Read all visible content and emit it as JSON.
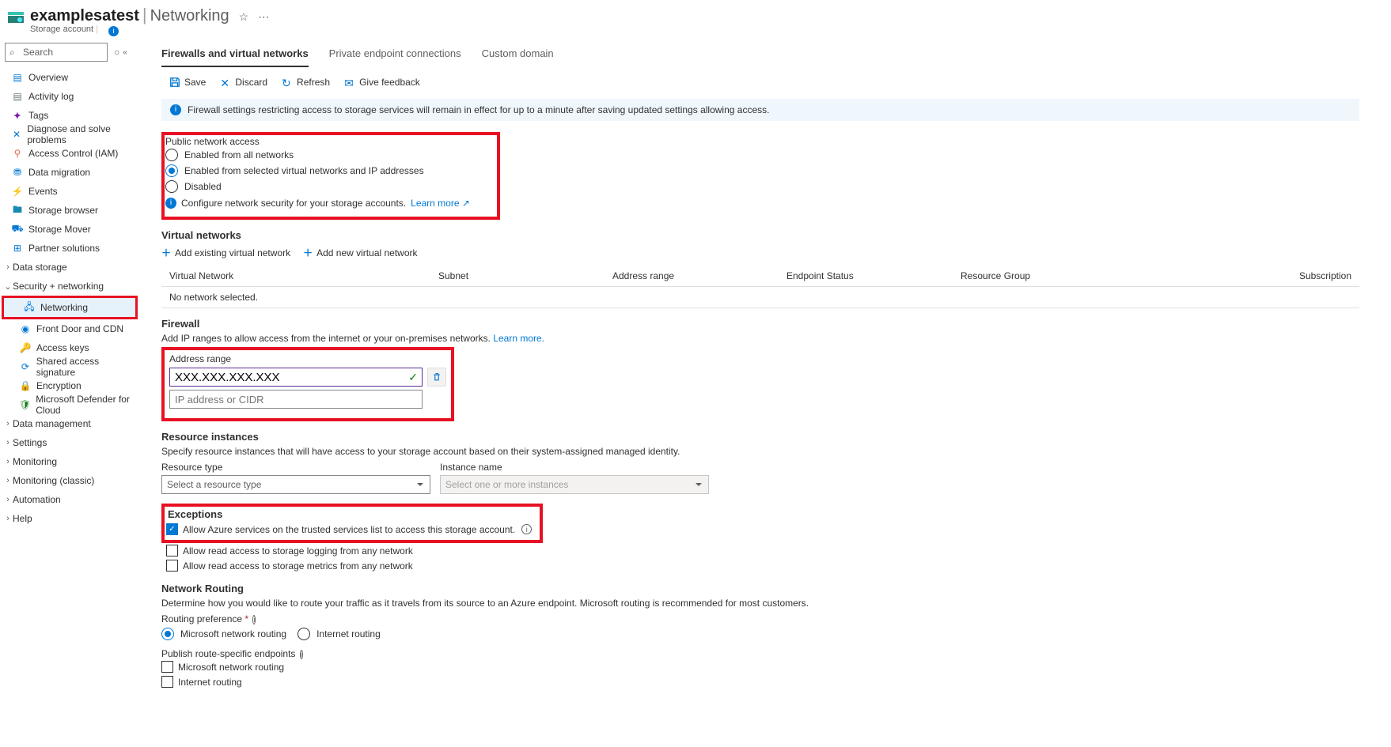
{
  "header": {
    "name": "examplesatest",
    "page": "Networking",
    "subtitle": "Storage account"
  },
  "sidebar": {
    "search_placeholder": "Search",
    "items": [
      {
        "icon": "overview",
        "label": "Overview",
        "color": "#0078d4"
      },
      {
        "icon": "activity",
        "label": "Activity log",
        "color": "#69797e"
      },
      {
        "icon": "tags",
        "label": "Tags",
        "color": "#7719aa"
      },
      {
        "icon": "diag",
        "label": "Diagnose and solve problems",
        "color": "#0078d4"
      },
      {
        "icon": "iam",
        "label": "Access Control (IAM)",
        "color": "#ef6950"
      },
      {
        "icon": "migr",
        "label": "Data migration",
        "color": "#0078d4"
      },
      {
        "icon": "events",
        "label": "Events",
        "color": "#ffaa44"
      },
      {
        "icon": "browser",
        "label": "Storage browser",
        "color": "#198ab3"
      },
      {
        "icon": "mover",
        "label": "Storage Mover",
        "color": "#0078d4"
      },
      {
        "icon": "partner",
        "label": "Partner solutions",
        "color": "#0078d4"
      }
    ],
    "groups": [
      {
        "chev": ">",
        "label": "Data storage"
      },
      {
        "chev": "v",
        "label": "Security + networking",
        "subs": [
          {
            "icon": "net",
            "label": "Networking",
            "selected": true,
            "color": "#0078d4"
          },
          {
            "icon": "fd",
            "label": "Front Door and CDN",
            "color": "#0078d4"
          },
          {
            "icon": "key",
            "label": "Access keys",
            "color": "#ffaa44"
          },
          {
            "icon": "sas",
            "label": "Shared access signature",
            "color": "#0078d4"
          },
          {
            "icon": "enc",
            "label": "Encryption",
            "color": "#0078d4"
          },
          {
            "icon": "mdc",
            "label": "Microsoft Defender for Cloud",
            "color": "#107c10"
          }
        ]
      },
      {
        "chev": ">",
        "label": "Data management"
      },
      {
        "chev": ">",
        "label": "Settings"
      },
      {
        "chev": ">",
        "label": "Monitoring"
      },
      {
        "chev": ">",
        "label": "Monitoring (classic)"
      },
      {
        "chev": ">",
        "label": "Automation"
      },
      {
        "chev": ">",
        "label": "Help"
      }
    ]
  },
  "tabs": [
    "Firewalls and virtual networks",
    "Private endpoint connections",
    "Custom domain"
  ],
  "toolbar": {
    "save": "Save",
    "discard": "Discard",
    "refresh": "Refresh",
    "feedback": "Give feedback"
  },
  "banner": "Firewall settings restricting access to storage services will remain in effect for up to a minute after saving updated settings allowing access.",
  "pna": {
    "title": "Public network access",
    "opts": [
      "Enabled from all networks",
      "Enabled from selected virtual networks and IP addresses",
      "Disabled"
    ],
    "selected": 1,
    "hint": "Configure network security for your storage accounts.",
    "learn": "Learn more"
  },
  "vn": {
    "title": "Virtual networks",
    "add_existing": "Add existing virtual network",
    "add_new": "Add new virtual network",
    "cols": [
      "Virtual Network",
      "Subnet",
      "Address range",
      "Endpoint Status",
      "Resource Group",
      "Subscription"
    ],
    "empty": "No network selected."
  },
  "fw": {
    "title": "Firewall",
    "desc": "Add IP ranges to allow access from the internet or your on-premises networks.",
    "learn": "Learn more.",
    "addr_label": "Address range",
    "addr_value": "XXX.XXX.XXX.XXX",
    "addr_placeholder": "IP address or CIDR"
  },
  "ri": {
    "title": "Resource instances",
    "desc": "Specify resource instances that will have access to your storage account based on their system-assigned managed identity.",
    "type_label": "Resource type",
    "type_placeholder": "Select a resource type",
    "name_label": "Instance name",
    "name_placeholder": "Select one or more instances"
  },
  "ex": {
    "title": "Exceptions",
    "opts": [
      {
        "label": "Allow Azure services on the trusted services list to access this storage account.",
        "checked": true,
        "info": true
      },
      {
        "label": "Allow read access to storage logging from any network",
        "checked": false
      },
      {
        "label": "Allow read access to storage metrics from any network",
        "checked": false
      }
    ]
  },
  "nr": {
    "title": "Network Routing",
    "desc": "Determine how you would like to route your traffic as it travels from its source to an Azure endpoint. Microsoft routing is recommended for most customers.",
    "pref_label": "Routing preference",
    "pref_opts": [
      "Microsoft network routing",
      "Internet routing"
    ],
    "pref_selected": 0,
    "publish_label": "Publish route-specific endpoints",
    "publish_opts": [
      {
        "label": "Microsoft network routing",
        "checked": false
      },
      {
        "label": "Internet routing",
        "checked": false
      }
    ]
  }
}
